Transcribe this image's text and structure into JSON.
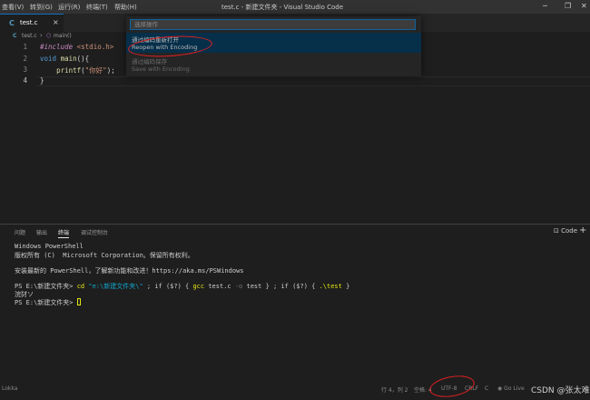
{
  "titlebar": {
    "menu": [
      "查看(V)",
      "转到(G)",
      "运行(R)",
      "终端(T)",
      "帮助(H)"
    ],
    "title": "test.c - 新建文件夹 - Visual Studio Code"
  },
  "tab": {
    "icon": "C",
    "label": "test.c",
    "close": "×"
  },
  "breadcrumb": {
    "file_icon": "C",
    "file": "test.c",
    "symbol": "main()"
  },
  "editor": {
    "line_numbers": [
      "1",
      "2",
      "3",
      "4"
    ],
    "line1": {
      "include": "#include",
      "header": "<stdio.h>"
    },
    "line2": {
      "type": "void",
      "fn": "main",
      "rest": "(){"
    },
    "line3": {
      "fn": "printf",
      "open": "(",
      "str": "\"你好\"",
      "close": ");"
    },
    "line4": "}"
  },
  "palette": {
    "placeholder": "选择操作",
    "items": [
      {
        "title": "通过编码重新打开",
        "subtitle": "Reopen with Encoding"
      },
      {
        "title": "通过编码保存",
        "subtitle": "Save with Encoding"
      }
    ]
  },
  "panel": {
    "tabs": [
      "问题",
      "输出",
      "终端",
      "调试控制台"
    ],
    "active_tab": "终端",
    "terminal_select": "Code",
    "terminal": {
      "l1": "Windows PowerShell",
      "l2": "版权所有 (C)  Microsoft Corporation。保留所有权利。",
      "l3": "安装最新的 PowerShell，了解新功能和改进！https://aka.ms/PSWindows",
      "l4_prompt": "PS E:\\新建文件夹> ",
      "l4_cd": "cd",
      "l4_path": "\"e:\\新建文件夹\\\"",
      "l4_mid": " ; if ($?) { ",
      "l4_gcc": "gcc",
      "l4_args": " test.c ",
      "l4_o": "-o",
      "l4_end": " test } ; if ($?) { ",
      "l4_run": ".\\test",
      "l4_close": " }",
      "l5": "浣犲ソ",
      "l6_prompt": "PS E:\\新建文件夹> "
    }
  },
  "statusbar": {
    "left": "Lokka",
    "position": "行 4，列 2",
    "spaces": "空格: 4",
    "encoding": "UTF-8",
    "eol": "CRLF",
    "lang": "C",
    "golive": "Go Live",
    "watermark": "CSDN @张太难"
  },
  "colors": {
    "background": "#1e1e1e",
    "accent": "#0e639c",
    "annotation": "#e02020"
  }
}
